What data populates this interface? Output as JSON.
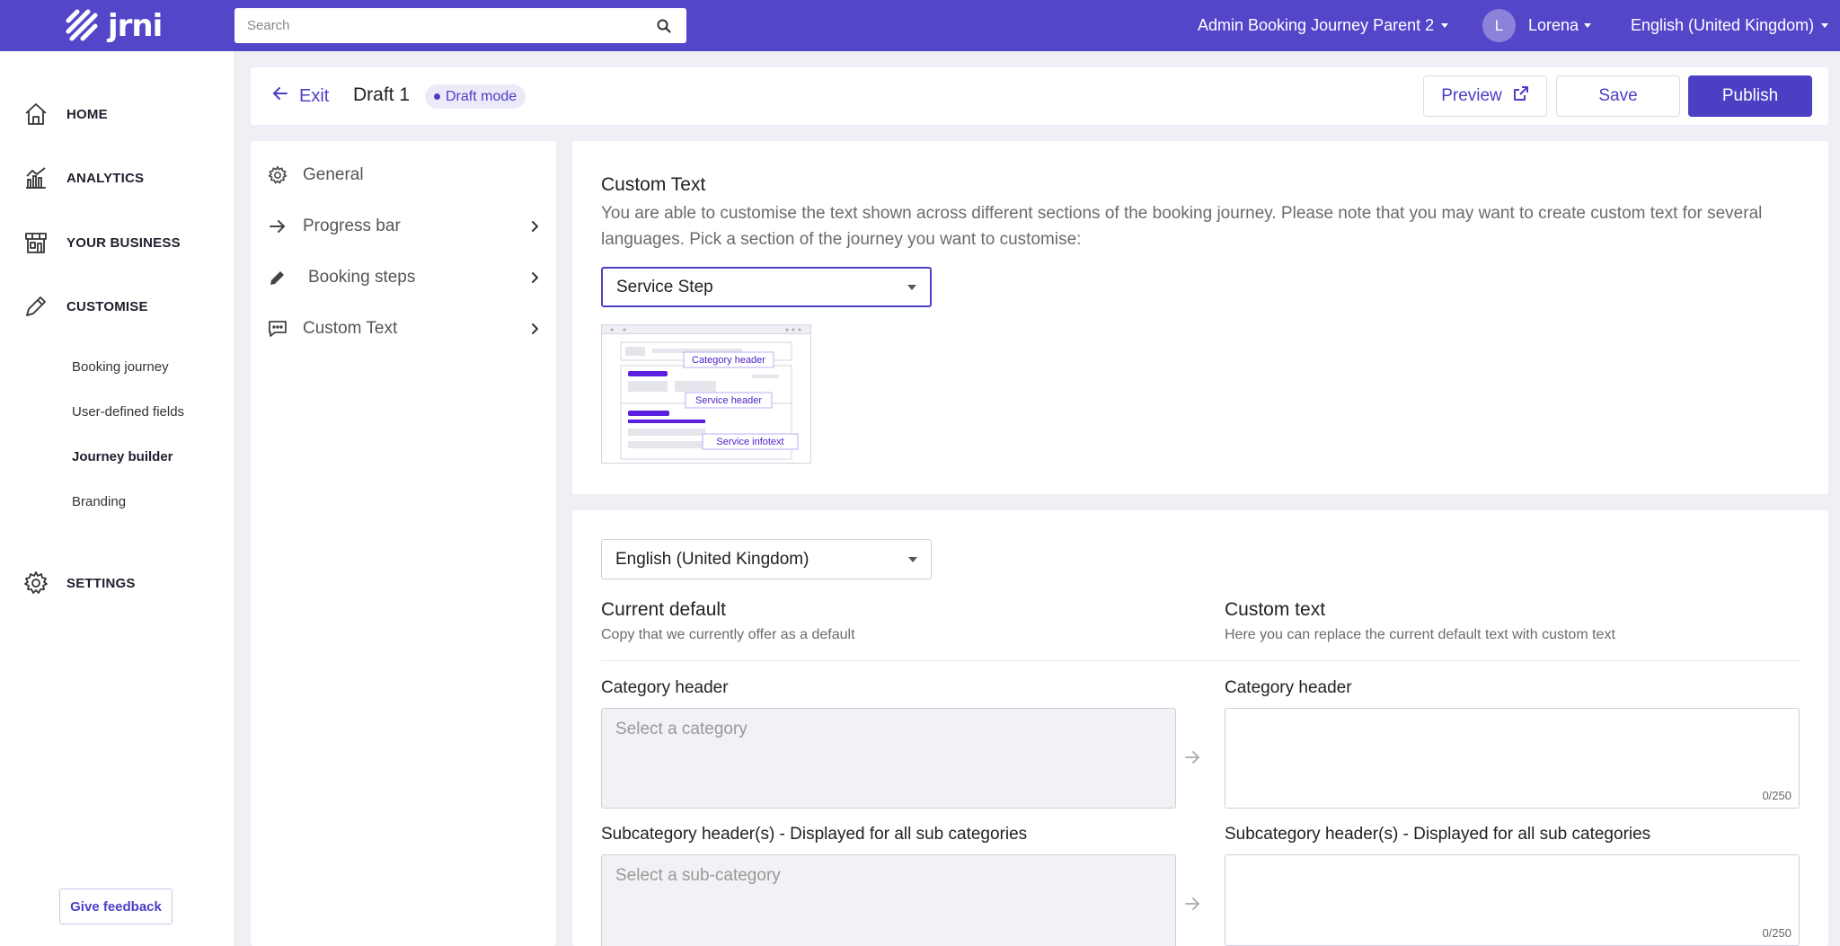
{
  "topbar": {
    "logo_text": "jrni",
    "search_placeholder": "Search",
    "company": "Admin Booking Journey Parent 2",
    "avatar_initial": "L",
    "user": "Lorena",
    "language": "English (United Kingdom)"
  },
  "sidebar": {
    "nav": [
      {
        "label": "HOME",
        "icon": "home-icon"
      },
      {
        "label": "ANALYTICS",
        "icon": "analytics-chart-icon"
      },
      {
        "label": "YOUR BUSINESS",
        "icon": "store-icon"
      },
      {
        "label": "CUSTOMISE",
        "icon": "pencil-icon"
      },
      {
        "label": "SETTINGS",
        "icon": "gear-icon"
      }
    ],
    "customise_sub": [
      "Booking journey",
      "User-defined fields",
      "Journey builder",
      "Branding"
    ],
    "active_sub": "Journey builder",
    "feedback": "Give feedback"
  },
  "header": {
    "exit": "Exit",
    "draft_title": "Draft 1",
    "draft_badge": "Draft mode",
    "preview": "Preview",
    "save": "Save",
    "publish": "Publish"
  },
  "settings_panel": {
    "items": [
      {
        "label": "General",
        "icon": "gear-icon",
        "has_chevron": false
      },
      {
        "label": "Progress bar",
        "icon": "arrow-right-icon",
        "has_chevron": true
      },
      {
        "label": "Booking steps",
        "icon": "pencil-icon",
        "has_chevron": true
      },
      {
        "label": "Custom Text",
        "icon": "chat-icon",
        "has_chevron": true
      }
    ]
  },
  "custom_text_card": {
    "title": "Custom Text",
    "description": "You are able to customise the text shown across different sections of the booking journey. Please note that you may want to create custom text for several languages. Pick a section of the journey you want to customise:",
    "section_select": "Service Step",
    "preview_labels": [
      "Category header",
      "Service header",
      "Service infotext"
    ]
  },
  "language_card": {
    "language_select": "English (United Kingdom)",
    "current_default_title": "Current default",
    "current_default_sub": "Copy that we currently offer as a default",
    "custom_text_title": "Custom text",
    "custom_text_sub": "Here you can replace the current default text with custom text",
    "fields": [
      {
        "label": "Category header",
        "default_placeholder": "Select a category",
        "custom_label": "Category header",
        "counter": "0/250"
      },
      {
        "label": "Subcategory header(s) - Displayed for all sub categories",
        "default_placeholder": "Select a sub-category",
        "custom_label": "Subcategory header(s) - Displayed for all sub categories",
        "counter": "0/250"
      }
    ]
  },
  "colors": {
    "brand": "#5446c9",
    "accent": "#4b3fc4"
  }
}
